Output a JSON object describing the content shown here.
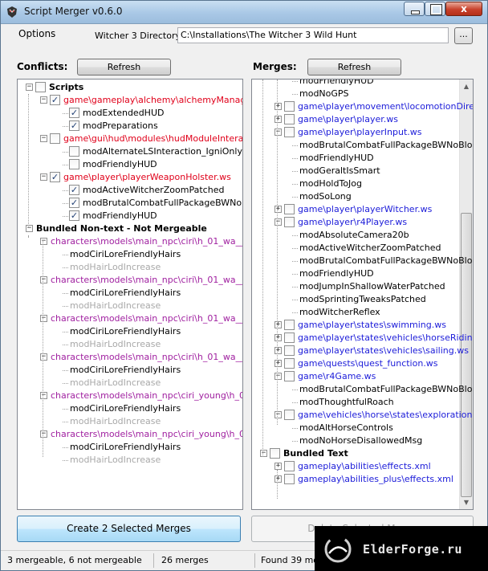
{
  "window": {
    "title": "Script Merger v0.6.0",
    "controls": {
      "close": "x"
    }
  },
  "menu": {
    "options": "Options"
  },
  "directory": {
    "label": "Witcher 3 Directory:",
    "value": "C:\\Installations\\The Witcher 3 Wild Hunt",
    "browse_label": "..."
  },
  "conflicts": {
    "title": "Conflicts:",
    "refresh_label": "Refresh",
    "rows": [
      {
        "level": 0,
        "exp": "−",
        "cb": "",
        "text": "Scripts",
        "color": "bold"
      },
      {
        "level": 1,
        "exp": "−",
        "cb": "✓",
        "text": "game\\gameplay\\alchemy\\alchemyManager.ws",
        "color": "red"
      },
      {
        "level": 2,
        "exp": "",
        "cb": "✓",
        "text": "modExtendedHUD",
        "color": ""
      },
      {
        "level": 2,
        "exp": "",
        "cb": "✓",
        "text": "modPreparations",
        "color": ""
      },
      {
        "level": 1,
        "exp": "−",
        "cb": "",
        "text": "game\\gui\\hud\\modules\\hudModuleInteractions",
        "color": "red"
      },
      {
        "level": 2,
        "exp": "",
        "cb": "",
        "text": "modAlternateLSInteraction_IgniOnly",
        "color": ""
      },
      {
        "level": 2,
        "exp": "",
        "cb": "",
        "text": "modFriendlyHUD",
        "color": ""
      },
      {
        "level": 1,
        "exp": "−",
        "cb": "✓",
        "text": "game\\player\\playerWeaponHolster.ws",
        "color": "red"
      },
      {
        "level": 2,
        "exp": "",
        "cb": "✓",
        "text": "modActiveWitcherZoomPatched",
        "color": ""
      },
      {
        "level": 2,
        "exp": "",
        "cb": "✓",
        "text": "modBrutalCombatFullPackageBWNoBlood",
        "color": ""
      },
      {
        "level": 2,
        "exp": "",
        "cb": "✓",
        "text": "modFriendlyHUD",
        "color": ""
      },
      {
        "level": 0,
        "exp": "−",
        "cb": null,
        "text": "Bundled Non-text - Not Mergeable",
        "color": "bold"
      },
      {
        "level": 1,
        "exp": "−",
        "cb": null,
        "text": "characters\\models\\main_npc\\ciri\\h_01_wa__ciri\\",
        "color": "purple"
      },
      {
        "level": 2,
        "exp": "",
        "cb": null,
        "text": "modCiriLoreFriendlyHairs",
        "color": ""
      },
      {
        "level": 2,
        "exp": "",
        "cb": null,
        "text": "modHairLodIncrease",
        "color": "grey"
      },
      {
        "level": 1,
        "exp": "−",
        "cb": null,
        "text": "characters\\models\\main_npc\\ciri\\h_01_wa__ciri\\",
        "color": "purple"
      },
      {
        "level": 2,
        "exp": "",
        "cb": null,
        "text": "modCiriLoreFriendlyHairs",
        "color": ""
      },
      {
        "level": 2,
        "exp": "",
        "cb": null,
        "text": "modHairLodIncrease",
        "color": "grey"
      },
      {
        "level": 1,
        "exp": "−",
        "cb": null,
        "text": "characters\\models\\main_npc\\ciri\\h_01_wa__ciri\\",
        "color": "purple"
      },
      {
        "level": 2,
        "exp": "",
        "cb": null,
        "text": "modCiriLoreFriendlyHairs",
        "color": ""
      },
      {
        "level": 2,
        "exp": "",
        "cb": null,
        "text": "modHairLodIncrease",
        "color": "grey"
      },
      {
        "level": 1,
        "exp": "−",
        "cb": null,
        "text": "characters\\models\\main_npc\\ciri\\h_01_wa__ciri\\",
        "color": "purple"
      },
      {
        "level": 2,
        "exp": "",
        "cb": null,
        "text": "modCiriLoreFriendlyHairs",
        "color": ""
      },
      {
        "level": 2,
        "exp": "",
        "cb": null,
        "text": "modHairLodIncrease",
        "color": "grey"
      },
      {
        "level": 1,
        "exp": "−",
        "cb": null,
        "text": "characters\\models\\main_npc\\ciri_young\\h_01_cw",
        "color": "purple"
      },
      {
        "level": 2,
        "exp": "",
        "cb": null,
        "text": "modCiriLoreFriendlyHairs",
        "color": ""
      },
      {
        "level": 2,
        "exp": "",
        "cb": null,
        "text": "modHairLodIncrease",
        "color": "grey"
      },
      {
        "level": 1,
        "exp": "−",
        "cb": null,
        "text": "characters\\models\\main_npc\\ciri_young\\h_01_cw",
        "color": "purple"
      },
      {
        "level": 2,
        "exp": "",
        "cb": null,
        "text": "modCiriLoreFriendlyHairs",
        "color": ""
      },
      {
        "level": 2,
        "exp": "",
        "cb": null,
        "text": "modHairLodIncrease",
        "color": "grey"
      }
    ]
  },
  "merges": {
    "title": "Merges:",
    "refresh_label": "Refresh",
    "rows": [
      {
        "level": 2,
        "exp": "",
        "cb": null,
        "text": "modFriendlyHUD",
        "color": ""
      },
      {
        "level": 2,
        "exp": "",
        "cb": null,
        "text": "modNoGPS",
        "color": ""
      },
      {
        "level": 1,
        "exp": "+",
        "cb": "",
        "text": "game\\player\\movement\\locomotionDirectC",
        "color": "blue"
      },
      {
        "level": 1,
        "exp": "+",
        "cb": "",
        "text": "game\\player\\player.ws",
        "color": "blue"
      },
      {
        "level": 1,
        "exp": "−",
        "cb": "",
        "text": "game\\player\\playerInput.ws",
        "color": "blue"
      },
      {
        "level": 2,
        "exp": "",
        "cb": null,
        "text": "modBrutalCombatFullPackageBWNoBloo",
        "color": ""
      },
      {
        "level": 2,
        "exp": "",
        "cb": null,
        "text": "modFriendlyHUD",
        "color": ""
      },
      {
        "level": 2,
        "exp": "",
        "cb": null,
        "text": "modGeraltIsSmart",
        "color": ""
      },
      {
        "level": 2,
        "exp": "",
        "cb": null,
        "text": "modHoldToJog",
        "color": ""
      },
      {
        "level": 2,
        "exp": "",
        "cb": null,
        "text": "modSoLong",
        "color": ""
      },
      {
        "level": 1,
        "exp": "+",
        "cb": "",
        "text": "game\\player\\playerWitcher.ws",
        "color": "blue"
      },
      {
        "level": 1,
        "exp": "−",
        "cb": "",
        "text": "game\\player\\r4Player.ws",
        "color": "blue"
      },
      {
        "level": 2,
        "exp": "",
        "cb": null,
        "text": "modAbsoluteCamera20b",
        "color": ""
      },
      {
        "level": 2,
        "exp": "",
        "cb": null,
        "text": "modActiveWitcherZoomPatched",
        "color": ""
      },
      {
        "level": 2,
        "exp": "",
        "cb": null,
        "text": "modBrutalCombatFullPackageBWNoBloo",
        "color": ""
      },
      {
        "level": 2,
        "exp": "",
        "cb": null,
        "text": "modFriendlyHUD",
        "color": ""
      },
      {
        "level": 2,
        "exp": "",
        "cb": null,
        "text": "modJumpInShallowWaterPatched",
        "color": ""
      },
      {
        "level": 2,
        "exp": "",
        "cb": null,
        "text": "modSprintingTweaksPatched",
        "color": ""
      },
      {
        "level": 2,
        "exp": "",
        "cb": null,
        "text": "modWitcherReflex",
        "color": ""
      },
      {
        "level": 1,
        "exp": "+",
        "cb": "",
        "text": "game\\player\\states\\swimming.ws",
        "color": "blue"
      },
      {
        "level": 1,
        "exp": "+",
        "cb": "",
        "text": "game\\player\\states\\vehicles\\horseRiding.w",
        "color": "blue"
      },
      {
        "level": 1,
        "exp": "+",
        "cb": "",
        "text": "game\\player\\states\\vehicles\\sailing.ws",
        "color": "blue"
      },
      {
        "level": 1,
        "exp": "+",
        "cb": "",
        "text": "game\\quests\\quest_function.ws",
        "color": "blue"
      },
      {
        "level": 1,
        "exp": "−",
        "cb": "",
        "text": "game\\r4Game.ws",
        "color": "blue"
      },
      {
        "level": 2,
        "exp": "",
        "cb": null,
        "text": "modBrutalCombatFullPackageBWNoBloo",
        "color": ""
      },
      {
        "level": 2,
        "exp": "",
        "cb": null,
        "text": "modThoughtfulRoach",
        "color": ""
      },
      {
        "level": 1,
        "exp": "−",
        "cb": "",
        "text": "game\\vehicles\\horse\\states\\exploration.ws",
        "color": "blue"
      },
      {
        "level": 2,
        "exp": "",
        "cb": null,
        "text": "modAltHorseControls",
        "color": ""
      },
      {
        "level": 2,
        "exp": "",
        "cb": null,
        "text": "modNoHorseDisallowedMsg",
        "color": ""
      },
      {
        "level": 0,
        "exp": "−",
        "cb": "",
        "text": "Bundled Text",
        "color": "bold"
      },
      {
        "level": 1,
        "exp": "+",
        "cb": "",
        "text": "gameplay\\abilities\\effects.xml",
        "color": "blue"
      },
      {
        "level": 1,
        "exp": "+",
        "cb": "",
        "text": "gameplay\\abilities_plus\\effects.xml",
        "color": "blue"
      }
    ]
  },
  "actions": {
    "create_label": "Create 2 Selected Merges",
    "delete_label": "Delete Selected Merge"
  },
  "status": {
    "mergeable": "3 mergeable, 6 not mergeable",
    "merges": "26 merges",
    "found": "Found 39 mod"
  },
  "watermark": {
    "text": "ElderForge.ru"
  }
}
